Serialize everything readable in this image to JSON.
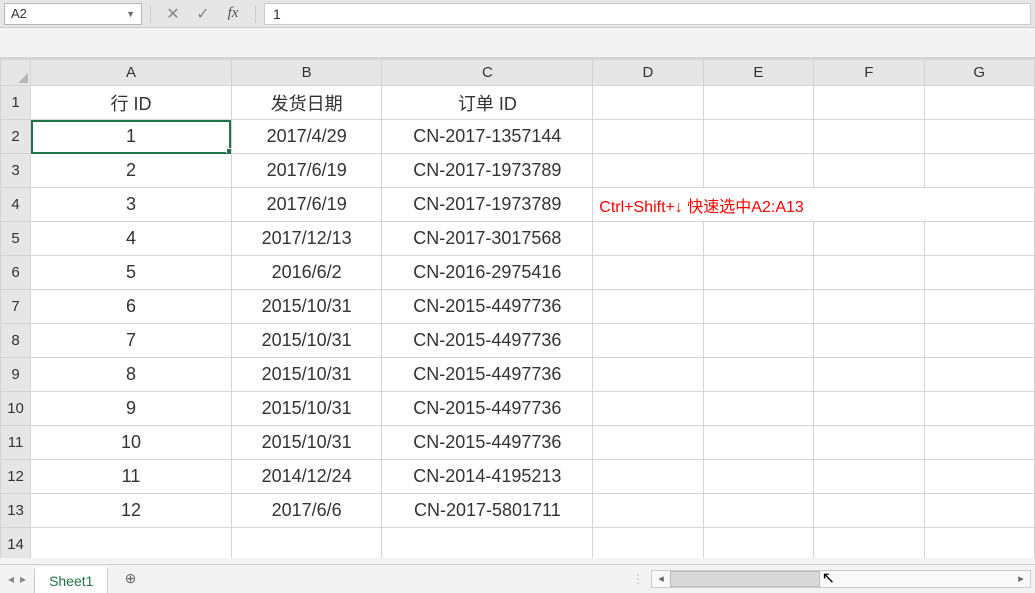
{
  "formula_bar": {
    "cell_ref": "A2",
    "cancel_label": "✕",
    "confirm_label": "✓",
    "fx_label": "fx",
    "value": "1"
  },
  "columns": [
    "A",
    "B",
    "C",
    "D",
    "E",
    "F",
    "G"
  ],
  "headers": {
    "A": "行 ID",
    "B": "发货日期",
    "C": "订单 ID"
  },
  "rows": [
    {
      "n": 1
    },
    {
      "n": 2,
      "A": "1",
      "B": "2017/4/29",
      "C": "CN-2017-1357144"
    },
    {
      "n": 3,
      "A": "2",
      "B": "2017/6/19",
      "C": "CN-2017-1973789"
    },
    {
      "n": 4,
      "A": "3",
      "B": "2017/6/19",
      "C": "CN-2017-1973789"
    },
    {
      "n": 5,
      "A": "4",
      "B": "2017/12/13",
      "C": "CN-2017-3017568"
    },
    {
      "n": 6,
      "A": "5",
      "B": "2016/6/2",
      "C": "CN-2016-2975416"
    },
    {
      "n": 7,
      "A": "6",
      "B": "2015/10/31",
      "C": "CN-2015-4497736"
    },
    {
      "n": 8,
      "A": "7",
      "B": "2015/10/31",
      "C": "CN-2015-4497736"
    },
    {
      "n": 9,
      "A": "8",
      "B": "2015/10/31",
      "C": "CN-2015-4497736"
    },
    {
      "n": 10,
      "A": "9",
      "B": "2015/10/31",
      "C": "CN-2015-4497736"
    },
    {
      "n": 11,
      "A": "10",
      "B": "2015/10/31",
      "C": "CN-2015-4497736"
    },
    {
      "n": 12,
      "A": "11",
      "B": "2014/12/24",
      "C": "CN-2014-4195213"
    },
    {
      "n": 13,
      "A": "12",
      "B": "2017/6/6",
      "C": "CN-2017-5801711"
    },
    {
      "n": 14
    }
  ],
  "annotation": {
    "row": 4,
    "text": "Ctrl+Shift+↓ 快速选中A2:A13"
  },
  "selected_cell": "A2",
  "tabs": {
    "active": "Sheet1",
    "add_label": "⊕"
  }
}
